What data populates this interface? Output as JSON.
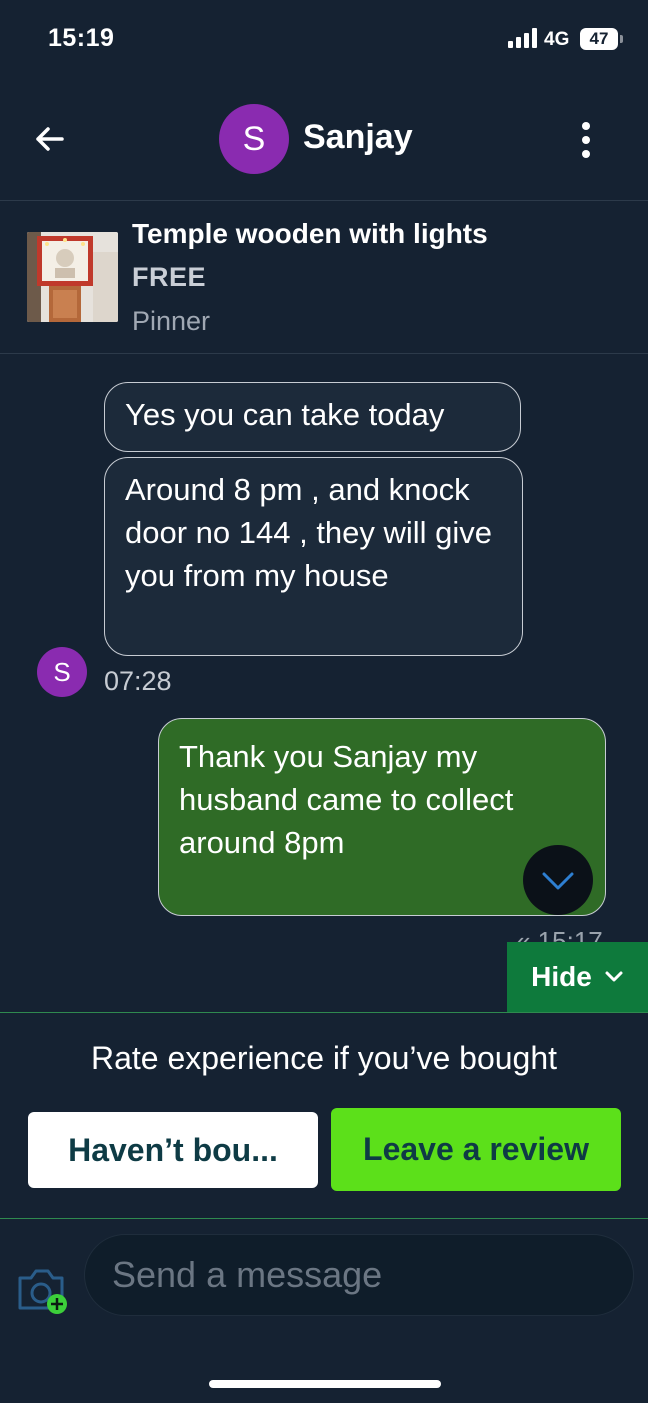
{
  "status_bar": {
    "time": "15:19",
    "network": "4G",
    "battery": "47"
  },
  "header": {
    "avatar_initial": "S",
    "contact_name": "Sanjay",
    "back_icon": "arrow-left-icon",
    "menu_icon": "more-vertical-icon"
  },
  "listing": {
    "title": "Temple wooden with lights",
    "price": "FREE",
    "location": "Pinner"
  },
  "messages": {
    "incoming": [
      "Yes you can take today",
      "Around 8 pm , and knock door no 144 , they will give you from my house"
    ],
    "incoming_avatar": "S",
    "incoming_time": "07:28",
    "outgoing": "Thank you Sanjay my husband came to collect around 8pm",
    "outgoing_time": "« 15:17"
  },
  "review_panel": {
    "hide_label": "Hide",
    "prompt": "Rate experience if you’ve bought",
    "havent_bought_label": "Haven’t bou...",
    "leave_review_label": "Leave a review"
  },
  "composer": {
    "placeholder": "Send a message"
  },
  "colors": {
    "background": "#152232",
    "avatar": "#8a2bb0",
    "outgoing_bubble": "#2f6b26",
    "hide_button": "#0e7a3c",
    "review_button": "#5ce01a"
  }
}
